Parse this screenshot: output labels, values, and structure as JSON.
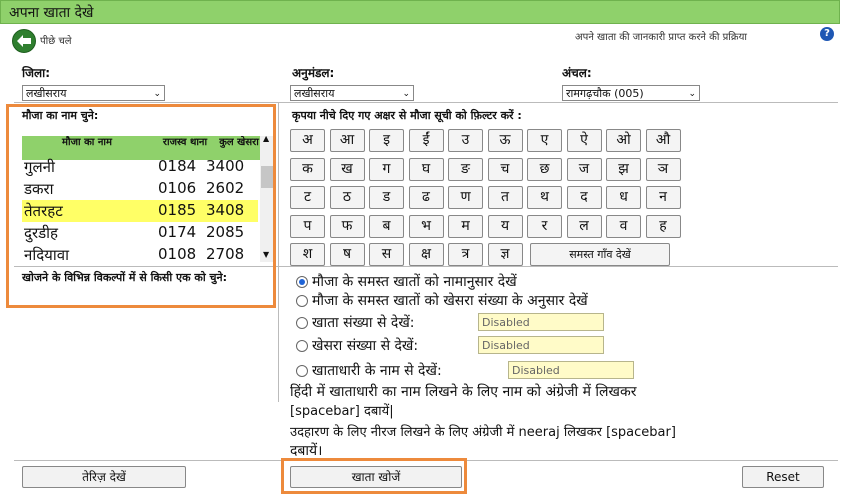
{
  "title": "अपना खाता देखे",
  "back_label": "पीछे चले",
  "process_label": "अपने खाता की जानकारी प्राप्त करने की प्रक्रिया",
  "help_glyph": "?",
  "district": {
    "label": "जिला:",
    "value": "लखीसराय"
  },
  "subdivision": {
    "label": "अनुमंडल:",
    "value": "लखीसराय"
  },
  "circle": {
    "label": "अंचल:",
    "value": "रामगढ़चौक (005)"
  },
  "mouza": {
    "heading": "मौजा का नाम चुने:",
    "columns": [
      "मौजा का नाम",
      "राजस्व थाना",
      "कुल खेसरा"
    ],
    "rows": [
      {
        "name": "गुलनी",
        "thana": "0184",
        "khesra": "3400"
      },
      {
        "name": "डकरा",
        "thana": "0106",
        "khesra": "2602"
      },
      {
        "name": "तेतरहट",
        "thana": "0185",
        "khesra": "3408",
        "selected": true
      },
      {
        "name": "दुरडीह",
        "thana": "0174",
        "khesra": "2085"
      },
      {
        "name": "नदियावा",
        "thana": "0108",
        "khesra": "2708"
      }
    ]
  },
  "filter": {
    "heading": "कृपया नीचे दिए गए अक्षर से मौजा सूची को फ़िल्टर करें :",
    "letters": [
      [
        "अ",
        "आ",
        "इ",
        "ईं",
        "उ",
        "ऊ",
        "ए",
        "ऐ",
        "ओ",
        "औ"
      ],
      [
        "क",
        "ख",
        "ग",
        "घ",
        "ङ",
        "च",
        "छ",
        "ज",
        "झ",
        "ञ"
      ],
      [
        "ट",
        "ठ",
        "ड",
        "ढ",
        "ण",
        "त",
        "थ",
        "द",
        "ध",
        "न"
      ],
      [
        "प",
        "फ",
        "ब",
        "भ",
        "म",
        "य",
        "र",
        "ल",
        "व",
        "ह"
      ],
      [
        "श",
        "ष",
        "स",
        "क्ष",
        "त्र",
        "ज्ञ"
      ]
    ],
    "all_villages": "समस्त गाँव देखें"
  },
  "options": {
    "label": "खोजने के विभिन्न विकल्पों में से किसी एक को चुने:",
    "items": [
      {
        "label": "मौजा के समस्त खातों को नामानुसार देखें",
        "checked": true
      },
      {
        "label": "मौजा के समस्त खातों को खेसरा संख्या के अनुसार देखें"
      },
      {
        "label": "खाता संख्या से देखें:",
        "input": "Disabled"
      },
      {
        "label": "खेसरा संख्या से देखें:",
        "input": "Disabled"
      },
      {
        "label": "खाताधारी के नाम से देखें:",
        "input": "Disabled"
      }
    ]
  },
  "help_text": {
    "line1": "हिंदी में खाताधारी का नाम लिखने के लिए नाम को अंग्रेजी में लिखकर",
    "line2": "[spacebar] दबायें|",
    "line3": "उदहारण के लिए नीरज लिखने के लिए अंग्रेजी में neeraj लिखकर [spacebar]",
    "line4": "दबायें।"
  },
  "buttons": {
    "map": "तेरिज़ देखें",
    "search": "खाता खोजें",
    "reset": "Reset"
  },
  "colors": {
    "header_green": "#8fd16b",
    "highlight_orange": "#ed8a3c",
    "selected_row": "#ffff66"
  }
}
